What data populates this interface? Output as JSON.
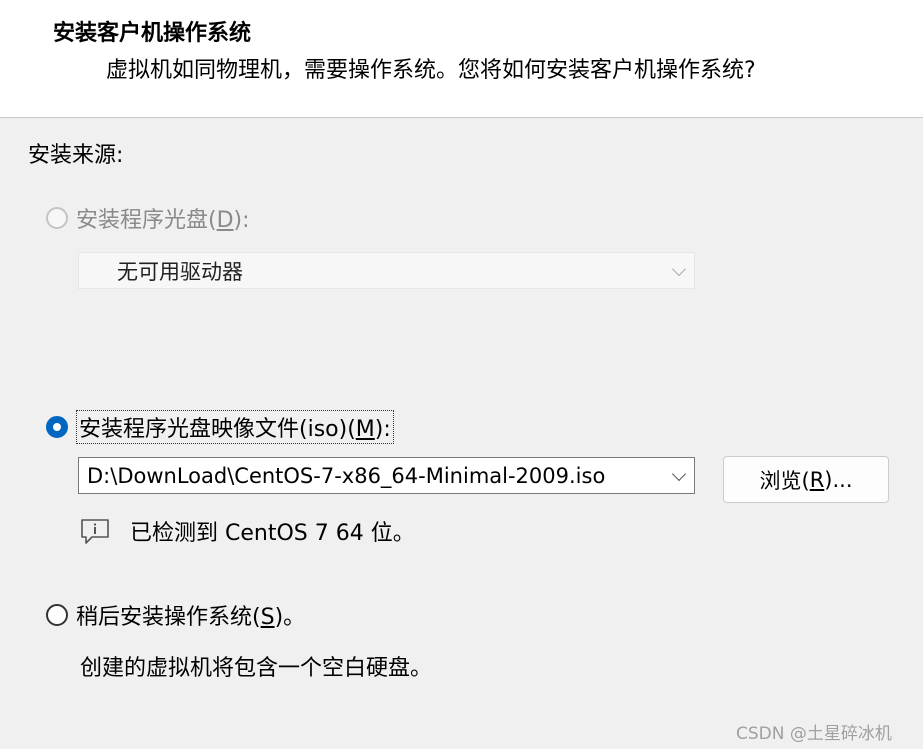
{
  "header": {
    "title": "安装客户机操作系统",
    "subtitle": "虚拟机如同物理机，需要操作系统。您将如何安装客户机操作系统?"
  },
  "install_source": {
    "label": "安装来源:",
    "option_disc": {
      "label_pre": "安装程序光盘(",
      "mnemonic": "D",
      "label_post": "):",
      "selected": false,
      "enabled": false,
      "dropdown_value": "无可用驱动器"
    },
    "option_iso": {
      "label_pre": "安装程序光盘映像文件(iso)(",
      "mnemonic": "M",
      "label_post": "):",
      "selected": true,
      "path_value": "D:\\DownLoad\\CentOS-7-x86_64-Minimal-2009.iso",
      "browse_pre": "浏览(",
      "browse_mnemonic": "R",
      "browse_post": ")...",
      "detected_text": "已检测到 CentOS 7 64 位。"
    },
    "option_later": {
      "label_pre": "稍后安装操作系统(",
      "mnemonic": "S",
      "label_post": ")。",
      "selected": false,
      "description": "创建的虚拟机将包含一个空白硬盘。"
    }
  },
  "watermark": "CSDN @土星碎冰机",
  "colors": {
    "accent": "#0067c0",
    "header_bg": "#ffffff",
    "body_bg": "#f0f0f0",
    "disabled_text": "#8a8a8a"
  },
  "icons": {
    "info": "info-speech-bubble-icon",
    "dropdown": "chevron-down-icon"
  }
}
